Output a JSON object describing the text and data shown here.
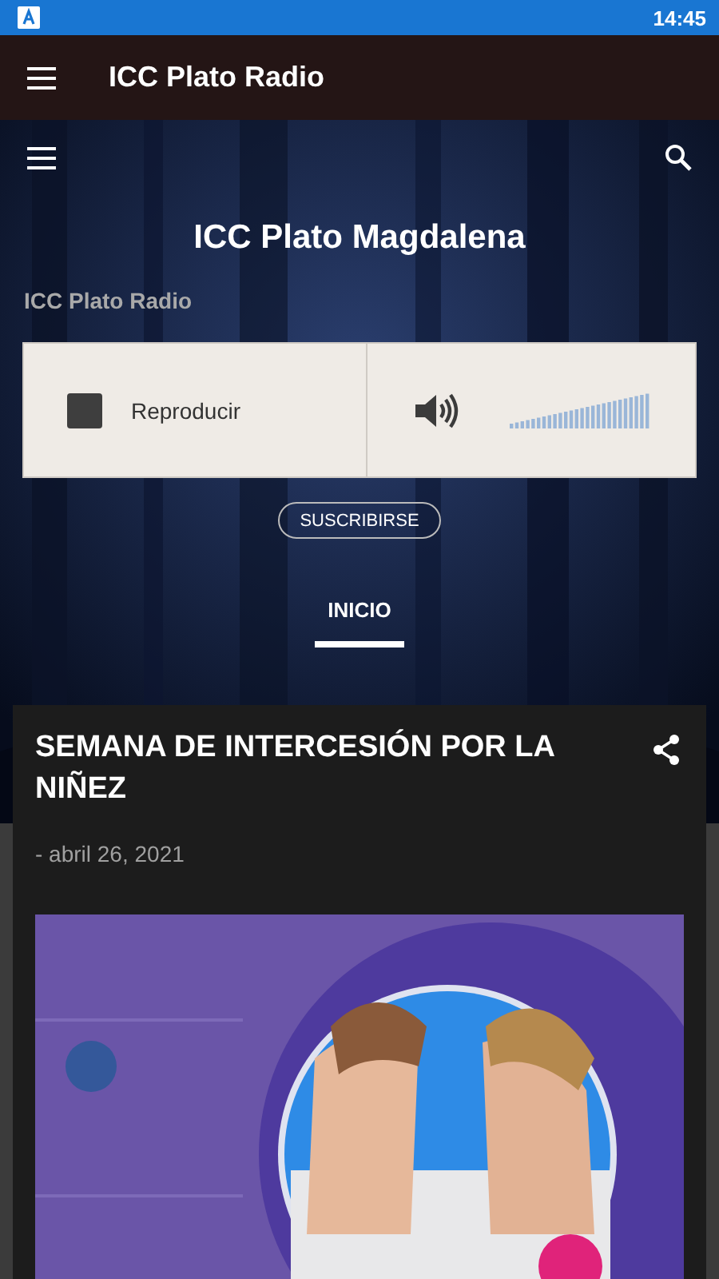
{
  "status_bar": {
    "time": "14:45"
  },
  "app_bar": {
    "title": "ICC Plato Radio"
  },
  "header": {
    "title": "ICC Plato Magdalena",
    "subtitle": "ICC Plato Radio"
  },
  "player": {
    "label": "Reproducir",
    "playing": true,
    "volume": {
      "level": 1
    }
  },
  "subscribe_button": "SUSCRIBIRSE",
  "tabs": [
    {
      "label": "INICIO",
      "selected": true
    }
  ],
  "post": {
    "title": "SEMANA DE INTERCESIÓN POR LA NIÑEZ",
    "date": "- abril 26, 2021"
  }
}
